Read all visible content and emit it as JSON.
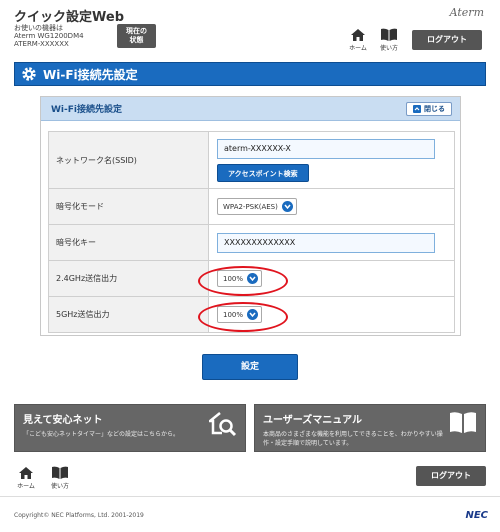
{
  "header": {
    "title": "クイック設定Web",
    "device_label": "お使いの機器は",
    "device_model": "Aterm WG1200DM4",
    "device_ssid": "ATERM-XXXXXX",
    "status_button_line1": "現在の",
    "status_button_line2": "状態",
    "brand": "Aterm",
    "home_label": "ホーム",
    "usage_label": "使い方",
    "logout_label": "ログアウト"
  },
  "page_title": "Wi-Fi接続先設定",
  "panel": {
    "title": "Wi-Fi接続先設定",
    "collapse_label": "閉じる",
    "rows": {
      "network_name_label": "ネットワーク名(SSID)",
      "network_name_value": "aterm-XXXXXX-X",
      "ap_search_label": "アクセスポイント検索",
      "encryption_mode_label": "暗号化モード",
      "encryption_mode_value": "WPA2-PSK(AES)",
      "encryption_key_label": "暗号化キー",
      "encryption_key_value": "XXXXXXXXXXXXX",
      "power_24_label": "2.4GHz送信出力",
      "power_24_value": "100%",
      "power_5_label": "5GHz送信出力",
      "power_5_value": "100%"
    }
  },
  "set_button_label": "設定",
  "banners": {
    "safety_title": "見えて安心ネット",
    "safety_desc": "「こども安心ネットタイマー」などの設定はこちらから。",
    "manual_title": "ユーザーズマニュアル",
    "manual_desc_line1": "本商品のさまざまな機能を利用してできることを、わかりやすい操",
    "manual_desc_line2": "作・設定手順で説明しています。"
  },
  "footer": {
    "home_label": "ホーム",
    "usage_label": "使い方",
    "logout_label": "ログアウト",
    "copyright": "Copyright© NEC Platforms, Ltd. 2001-2019",
    "nec_logo": "NEC"
  },
  "colors": {
    "primary_blue": "#1a6bbf",
    "panel_header": "#c9ddf2",
    "dark_button": "#555555",
    "highlight_red": "#e0141e"
  }
}
